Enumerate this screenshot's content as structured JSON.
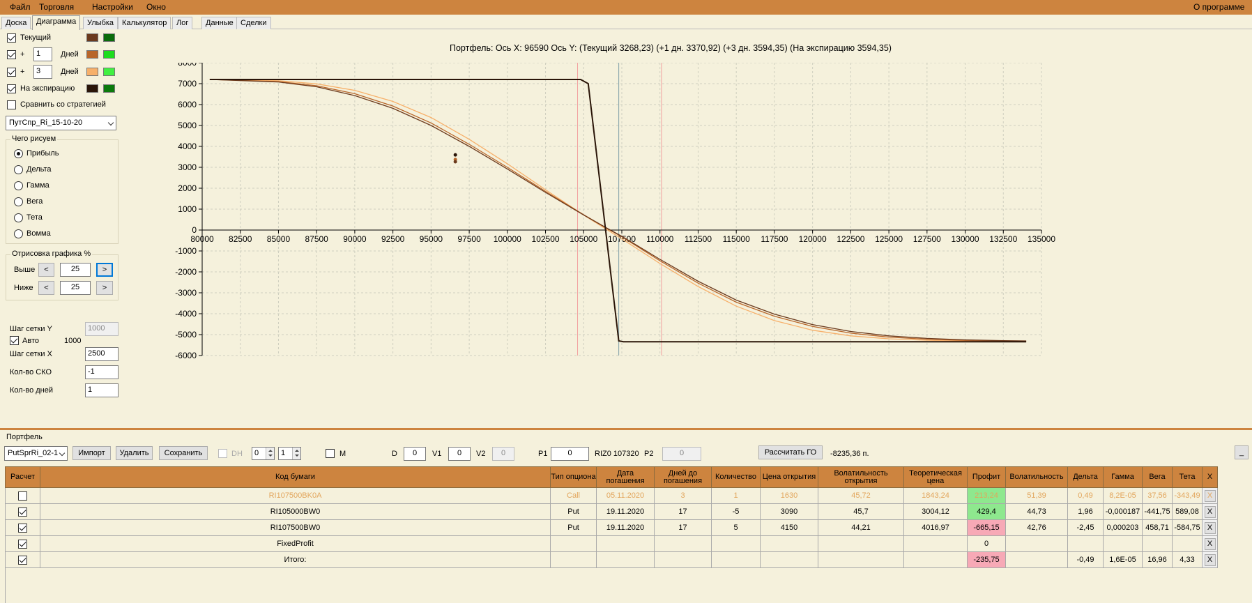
{
  "menu": {
    "file": "Файл",
    "trade": "Торговля",
    "settings": "Настройки",
    "window": "Окно",
    "about": "О программе"
  },
  "tabs": [
    "Доска",
    "Диаграмма",
    "Улыбка",
    "Калькулятор",
    "Лог",
    "Данные",
    "Сделки"
  ],
  "left": {
    "current_label": "Текущий",
    "plus1_sign": "+",
    "plus1_value": "1",
    "plus1_unit": "Дней",
    "plus3_sign": "+",
    "plus3_value": "3",
    "plus3_unit": "Дней",
    "expiry_label": "На экспирацию",
    "compare_label": "Сравнить со стратегией",
    "strategy_value": "ПутСпр_Ri_15-10-20",
    "draw_group": "Чего рисуем",
    "radios": [
      "Прибыль",
      "Дельта",
      "Гамма",
      "Вега",
      "Тета",
      "Вомма"
    ],
    "plot_group": "Отрисовка графика %",
    "above_label": "Выше",
    "above_value": "25",
    "below_label": "Ниже",
    "below_value": "25",
    "btn_left": "<",
    "btn_right": ">",
    "grid_y_label": "Шаг сетки Y",
    "grid_y_value": "1000",
    "auto_label": "Авто",
    "auto_value": "1000",
    "grid_x_label": "Шаг сетки X",
    "grid_x_value": "2500",
    "sko_label": "Кол-во СКО",
    "sko_value": "-1",
    "days_label": "Кол-во дней",
    "days_value": "1"
  },
  "colors": {
    "current_a": "#6b3a1d",
    "current_b": "#0a6b0a",
    "plus1_a": "#b8662a",
    "plus1_b": "#1edc1e",
    "plus3_a": "#f7b06a",
    "plus3_b": "#41f041",
    "expiry_a": "#2a1508",
    "expiry_b": "#0b7a0b"
  },
  "chart_title": "Портфель: Ось X: 96590 Ось Y:  (Текущий 3268,23)  (+1 дн. 3370,92)  (+3 дн. 3594,35)  (На экспирацию 3594,35)",
  "chart_data": {
    "type": "line",
    "xlim": [
      80000,
      135000
    ],
    "ylim": [
      -6000,
      8000
    ],
    "x_ticks": [
      "80000",
      "82500",
      "85000",
      "87500",
      "90000",
      "92500",
      "95000",
      "97500",
      "100000",
      "102500",
      "105000",
      "107500",
      "110000",
      "112500",
      "115000",
      "117500",
      "120000",
      "122500",
      "125000",
      "127500",
      "130000",
      "132500",
      "135000"
    ],
    "y_ticks": [
      "8000",
      "7000",
      "6000",
      "5000",
      "4000",
      "3000",
      "2000",
      "1000",
      "0",
      "-1000",
      "-2000",
      "-3000",
      "-4000",
      "-5000",
      "-6000"
    ],
    "grid": true,
    "vlines": [
      {
        "x": 104600,
        "color": "#f2a0a0"
      },
      {
        "x": 107300,
        "color": "#7fa0a8"
      },
      {
        "x": 110100,
        "color": "#f2a0a0"
      }
    ],
    "series": [
      {
        "color": "#2a1508",
        "points": [
          [
            80500,
            7200
          ],
          [
            104800,
            7200
          ],
          [
            105300,
            7000
          ],
          [
            107300,
            -5300
          ],
          [
            107600,
            -5340
          ],
          [
            134000,
            -5340
          ]
        ]
      },
      {
        "color": "#6b3a1d",
        "points": [
          [
            80500,
            7200
          ],
          [
            85000,
            7080
          ],
          [
            87500,
            6850
          ],
          [
            90000,
            6430
          ],
          [
            92500,
            5820
          ],
          [
            95000,
            5000
          ],
          [
            97500,
            4000
          ],
          [
            100000,
            2920
          ],
          [
            102500,
            1800
          ],
          [
            105000,
            720
          ],
          [
            106500,
            100
          ],
          [
            107500,
            -300
          ],
          [
            110000,
            -1400
          ],
          [
            112500,
            -2450
          ],
          [
            115000,
            -3350
          ],
          [
            117500,
            -4020
          ],
          [
            120000,
            -4520
          ],
          [
            122500,
            -4850
          ],
          [
            125000,
            -5060
          ],
          [
            127500,
            -5180
          ],
          [
            130000,
            -5250
          ],
          [
            132500,
            -5290
          ],
          [
            134000,
            -5300
          ]
        ]
      },
      {
        "color": "#b8662a",
        "points": [
          [
            80500,
            7200
          ],
          [
            85000,
            7100
          ],
          [
            87500,
            6900
          ],
          [
            90000,
            6520
          ],
          [
            92500,
            5930
          ],
          [
            95000,
            5120
          ],
          [
            97500,
            4100
          ],
          [
            100000,
            3000
          ],
          [
            102500,
            1850
          ],
          [
            105000,
            730
          ],
          [
            106500,
            90
          ],
          [
            107500,
            -320
          ],
          [
            110000,
            -1470
          ],
          [
            112500,
            -2540
          ],
          [
            115000,
            -3450
          ],
          [
            117500,
            -4120
          ],
          [
            120000,
            -4610
          ],
          [
            122500,
            -4930
          ],
          [
            125000,
            -5120
          ],
          [
            127500,
            -5220
          ],
          [
            130000,
            -5280
          ],
          [
            132500,
            -5310
          ],
          [
            134000,
            -5310
          ]
        ]
      },
      {
        "color": "#f7b06a",
        "points": [
          [
            80500,
            7200
          ],
          [
            85000,
            7140
          ],
          [
            87500,
            6990
          ],
          [
            90000,
            6680
          ],
          [
            92500,
            6150
          ],
          [
            95000,
            5380
          ],
          [
            97500,
            4340
          ],
          [
            100000,
            3170
          ],
          [
            102500,
            1930
          ],
          [
            105000,
            720
          ],
          [
            106500,
            30
          ],
          [
            107500,
            -420
          ],
          [
            110000,
            -1600
          ],
          [
            112500,
            -2700
          ],
          [
            115000,
            -3640
          ],
          [
            117500,
            -4330
          ],
          [
            120000,
            -4790
          ],
          [
            122500,
            -5060
          ],
          [
            125000,
            -5200
          ],
          [
            127500,
            -5270
          ],
          [
            130000,
            -5310
          ],
          [
            132500,
            -5320
          ],
          [
            134000,
            -5320
          ]
        ]
      }
    ],
    "points": [
      {
        "x": 96590,
        "y": 3594,
        "color": "#2a1508"
      },
      {
        "x": 96590,
        "y": 3370,
        "color": "#b8662a"
      },
      {
        "x": 96590,
        "y": 3268,
        "color": "#6b3a1d"
      }
    ]
  },
  "portfolio": {
    "title": "Портфель",
    "combo": "PutSprRi_02-1",
    "import": "Импорт",
    "delete": "Удалить",
    "save": "Сохранить",
    "dh_label": "DH",
    "spin1": "0",
    "spin2": "1",
    "m_label": "M",
    "d_label": "D",
    "d_value": "0",
    "v1_label": "V1",
    "v1_value": "0",
    "v2_label": "V2",
    "v2_value": "0",
    "p1_label": "P1",
    "p1_value": "0",
    "riz_label": "RIZ0 107320",
    "p2_label": "P2",
    "p2_value": "0",
    "calc_go": "Рассчитать ГО",
    "go_value": "-8235,36 п.",
    "min_btn": "_"
  },
  "table": {
    "headers": [
      "Расчет",
      "Код бумаги",
      "Тип опциона",
      "Дата погашения",
      "Дней до погашения",
      "Количество",
      "Цена открытия",
      "Волатильность открытия",
      "Теоретическая цена",
      "Профит",
      "Волатильность",
      "Дельта",
      "Гамма",
      "Вега",
      "Тета",
      "X"
    ],
    "rows": [
      {
        "check": false,
        "hl": true,
        "cells": [
          "RI107500BK0A",
          "Call",
          "05.11.2020",
          "3",
          "1",
          "1630",
          "45,72",
          "1843,24",
          "213,24",
          "51,39",
          "0,49",
          "8,2E-05",
          "37,56",
          "-343,49"
        ],
        "pcls": "pos"
      },
      {
        "check": true,
        "hl": false,
        "cells": [
          "RI105000BW0",
          "Put",
          "19.11.2020",
          "17",
          "-5",
          "3090",
          "45,7",
          "3004,12",
          "429,4",
          "44,73",
          "1,96",
          "-0,000187",
          "-441,75",
          "589,08"
        ],
        "pcls": "pos"
      },
      {
        "check": true,
        "hl": false,
        "cells": [
          "RI107500BW0",
          "Put",
          "19.11.2020",
          "17",
          "5",
          "4150",
          "44,21",
          "4016,97",
          "-665,15",
          "42,76",
          "-2,45",
          "0,000203",
          "458,71",
          "-584,75"
        ],
        "pcls": "neg"
      },
      {
        "check": true,
        "hl": false,
        "cells": [
          "FixedProfit",
          "",
          "",
          "",
          "",
          "",
          "",
          "",
          "0",
          "",
          "",
          "",
          "",
          ""
        ],
        "pcls": ""
      },
      {
        "check": true,
        "hl": false,
        "cells": [
          "Итого:",
          "",
          "",
          "",
          "",
          "",
          "",
          "",
          "-235,75",
          "",
          "-0,49",
          "1,6E-05",
          "16,96",
          "4,33"
        ],
        "pcls": "neg"
      }
    ],
    "x_label": "X"
  }
}
